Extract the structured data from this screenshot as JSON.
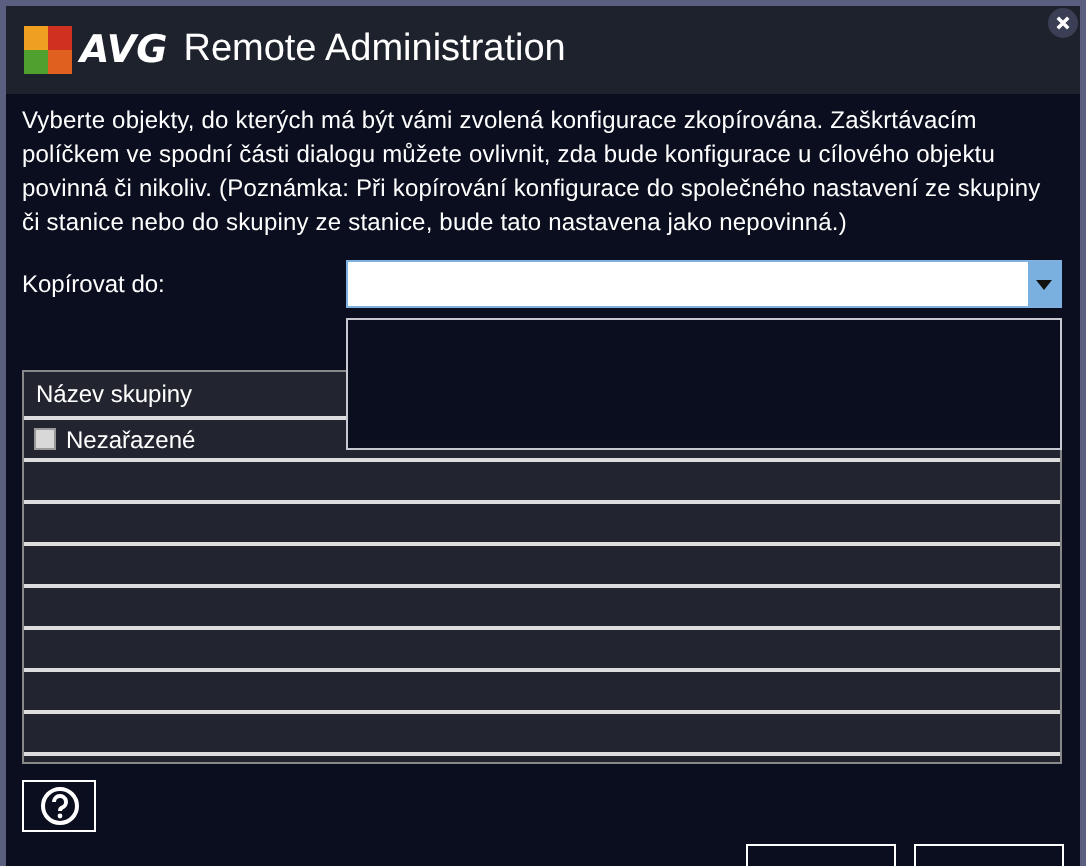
{
  "window": {
    "logo": "AVG",
    "title": "Remote Administration"
  },
  "instructions": "Vyberte objekty, do kterých má být vámi zvolená konfigurace zkopírována. Zaškrtávacím políčkem ve spodní části dialogu můžete ovlivnit, zda bude konfigurace u cílového objektu povinná či nikoliv. (Poznámka: Při kopírování konfigurace do společného nastavení ze skupiny či stanice nebo do skupiny ze stanice, bude tato nastavena jako nepovinná.)",
  "copy_to": {
    "label": "Kopírovat do:",
    "expanded": true
  },
  "table": {
    "columns": [
      "Název skupiny"
    ],
    "rows": [
      {
        "name": "Nezařazené",
        "checked": false
      }
    ]
  }
}
